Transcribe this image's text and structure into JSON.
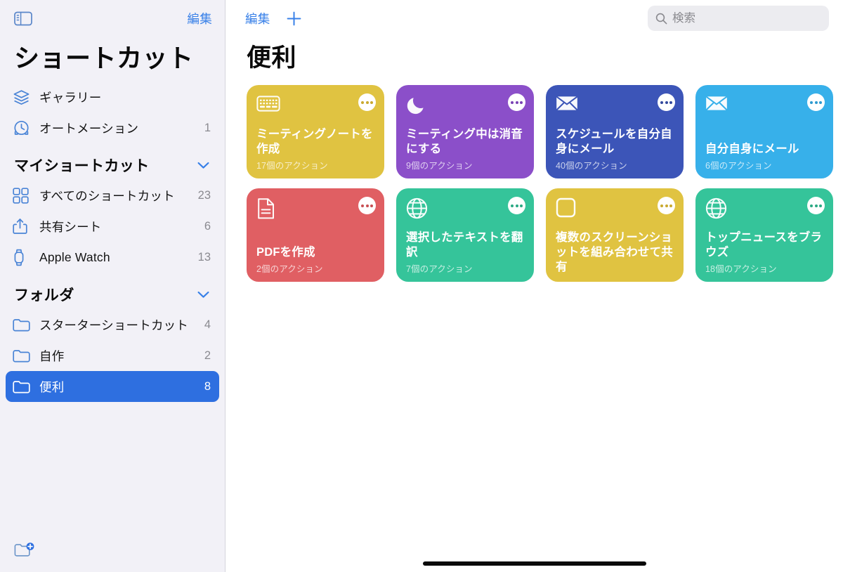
{
  "sidebar": {
    "toggle_icon": "sidebar-toggle-icon",
    "edit_label": "編集",
    "title": "ショートカット",
    "top_items": [
      {
        "icon": "gallery-stack-icon",
        "label": "ギャラリー",
        "count": ""
      },
      {
        "icon": "automation-clock-icon",
        "label": "オートメーション",
        "count": "1"
      }
    ],
    "my_shortcuts": {
      "header": "マイショートカット",
      "chevron": "chevron-down-icon",
      "items": [
        {
          "icon": "grid-squares-icon",
          "label": "すべてのショートカット",
          "count": "23"
        },
        {
          "icon": "share-sheet-icon",
          "label": "共有シート",
          "count": "6"
        },
        {
          "icon": "apple-watch-icon",
          "label": "Apple Watch",
          "count": "13"
        }
      ]
    },
    "folders": {
      "header": "フォルダ",
      "chevron": "chevron-down-icon",
      "items": [
        {
          "icon": "folder-icon",
          "label": "スターターショートカット",
          "count": "4",
          "selected": false
        },
        {
          "icon": "folder-icon",
          "label": "自作",
          "count": "2",
          "selected": false
        },
        {
          "icon": "folder-icon",
          "label": "便利",
          "count": "8",
          "selected": true
        }
      ]
    },
    "new_folder_icon": "new-folder-icon",
    "selected_color": "#2e6fe0",
    "accent_color": "#3880e8",
    "background_color": "#f2f1f7"
  },
  "main": {
    "edit_label": "編集",
    "add_icon": "plus-icon",
    "search": {
      "icon": "search-icon",
      "placeholder": "検索",
      "value": ""
    },
    "title": "便利",
    "cards": [
      {
        "title": "ミーティングノートを作成",
        "subtitle": "17個のアクション",
        "icon": "keyboard-icon",
        "color": "#e0c341",
        "dots": "ellipsis-icon",
        "dots_color": "#c9a92f"
      },
      {
        "title": "ミーティング中は消音にする",
        "subtitle": "9個のアクション",
        "icon": "moon-icon",
        "color": "#8b4fc9",
        "dots": "ellipsis-icon",
        "dots_color": "#7a42b5"
      },
      {
        "title": "スケジュールを自分自身にメール",
        "subtitle": "40個のアクション",
        "icon": "envelope-icon",
        "color": "#3c55b8",
        "dots": "ellipsis-icon",
        "dots_color": "#33499e"
      },
      {
        "title": "自分自身にメール",
        "subtitle": "6個のアクション",
        "icon": "envelope-icon",
        "color": "#37b0ea",
        "dots": "ellipsis-icon",
        "dots_color": "#2d9ad0"
      },
      {
        "title": "PDFを作成",
        "subtitle": "2個のアクション",
        "icon": "document-icon",
        "color": "#e05f63",
        "dots": "ellipsis-icon",
        "dots_color": "#c84f53"
      },
      {
        "title": "選択したテキストを翻訳",
        "subtitle": "7個のアクション",
        "icon": "globe-icon",
        "color": "#35c49a",
        "dots": "ellipsis-icon",
        "dots_color": "#2aa983"
      },
      {
        "title": "複数のスクリーンショットを組み合わせて共有",
        "subtitle": "",
        "icon": "rounded-square-icon",
        "color": "#e0c341",
        "dots": "ellipsis-icon",
        "dots_color": "#c9a92f"
      },
      {
        "title": "トップニュースをブラウズ",
        "subtitle": "18個のアクション",
        "icon": "globe-icon",
        "color": "#35c49a",
        "dots": "ellipsis-icon",
        "dots_color": "#2aa983"
      }
    ]
  }
}
